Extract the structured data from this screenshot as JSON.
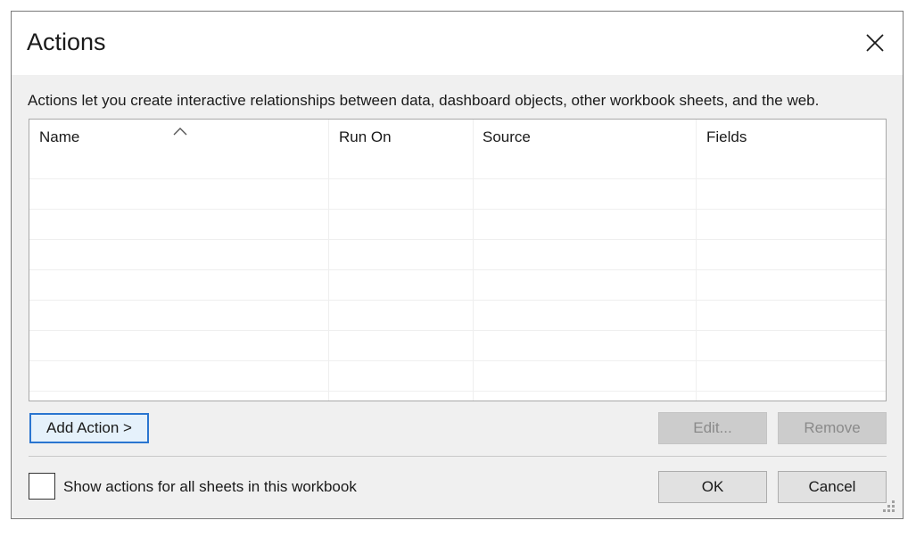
{
  "dialog": {
    "title": "Actions",
    "close_icon": "close-icon",
    "description": "Actions let you create interactive relationships between data, dashboard objects, other workbook sheets, and the web."
  },
  "table": {
    "columns": [
      "Name",
      "Run On",
      "Source",
      "Fields"
    ],
    "sorted_column": "Name",
    "sort_icon": "sort-up-icon",
    "rows": []
  },
  "buttons": {
    "add_action": "Add Action >",
    "edit": "Edit...",
    "remove": "Remove",
    "ok": "OK",
    "cancel": "Cancel"
  },
  "show_all": {
    "label": "Show actions for all sheets in this workbook",
    "checked": false
  },
  "colors": {
    "dialog_bg": "#f0f0f0",
    "primary_border": "#2a75d0",
    "disabled_bg": "#cccccc"
  }
}
